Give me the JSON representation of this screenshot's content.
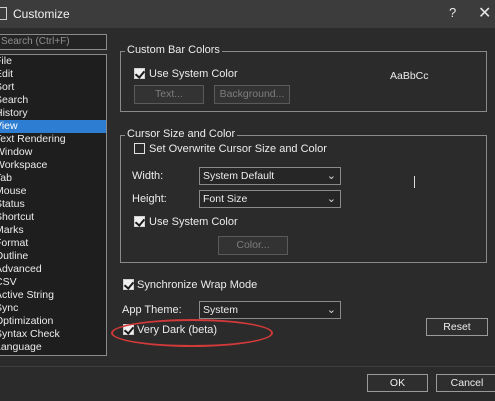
{
  "window": {
    "title": "Customize",
    "help_label": "?",
    "close_label": "✕"
  },
  "sidebar": {
    "search_placeholder": "Search (Ctrl+F)",
    "items": [
      {
        "label": "File"
      },
      {
        "label": "Edit"
      },
      {
        "label": "Sort"
      },
      {
        "label": "Search"
      },
      {
        "label": "History"
      },
      {
        "label": "View",
        "selected": true
      },
      {
        "label": "Text Rendering"
      },
      {
        "label": "Window"
      },
      {
        "label": "Workspace"
      },
      {
        "label": "Tab"
      },
      {
        "label": "Mouse"
      },
      {
        "label": "Status"
      },
      {
        "label": "Shortcut"
      },
      {
        "label": "Marks"
      },
      {
        "label": "Format"
      },
      {
        "label": "Outline"
      },
      {
        "label": "Advanced"
      },
      {
        "label": "CSV"
      },
      {
        "label": "Active String"
      },
      {
        "label": "Sync"
      },
      {
        "label": "Optimization"
      },
      {
        "label": "Syntax Check"
      },
      {
        "label": "Language"
      }
    ]
  },
  "custom_bar_colors": {
    "title": "Custom Bar Colors",
    "use_system_color_label": "Use System Color",
    "use_system_color_checked": true,
    "text_button": "Text...",
    "background_button": "Background...",
    "sample_text": "AaBbCc"
  },
  "cursor_size_color": {
    "title": "Cursor Size and Color",
    "overwrite_label": "Set Overwrite Cursor Size and Color",
    "overwrite_checked": false,
    "width_label": "Width:",
    "width_value": "System Default",
    "height_label": "Height:",
    "height_value": "Font Size",
    "use_system_color_label": "Use System Color",
    "use_system_color_checked": true,
    "color_button": "Color..."
  },
  "sync_wrap": {
    "label": "Synchronize Wrap Mode",
    "checked": true
  },
  "app_theme": {
    "label": "App Theme:",
    "value": "System"
  },
  "very_dark": {
    "label": "Very Dark (beta)",
    "checked": true
  },
  "buttons": {
    "reset": "Reset",
    "ok": "OK",
    "cancel": "Cancel"
  },
  "colors": {
    "background": "#2b2b2b",
    "selection": "#2d7dd2",
    "annotation": "#d23a3a"
  }
}
